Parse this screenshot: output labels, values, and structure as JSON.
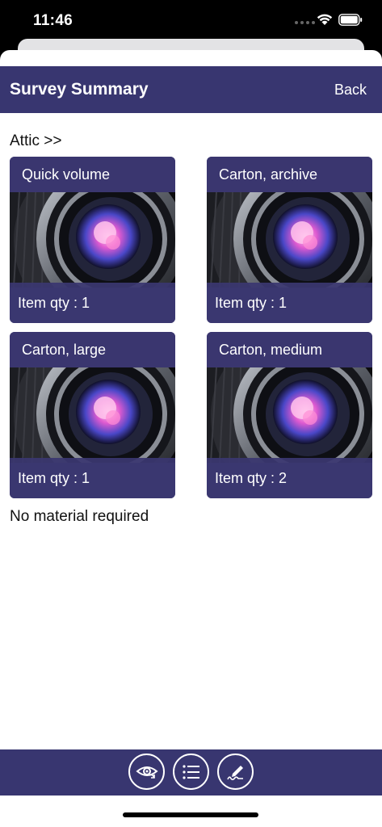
{
  "status": {
    "time": "11:46"
  },
  "nav": {
    "title": "Survey Summary",
    "back_label": "Back"
  },
  "section": {
    "title": "Attic >>"
  },
  "cards": [
    {
      "title": "Quick volume",
      "qty": "Item qty : 1"
    },
    {
      "title": "Carton, archive",
      "qty": "Item qty : 1"
    },
    {
      "title": "Carton, large",
      "qty": "Item qty : 1"
    },
    {
      "title": "Carton, medium",
      "qty": "Item qty : 2"
    }
  ],
  "footer": {
    "note": "No material required"
  },
  "tabbar": {
    "icons": [
      "eye-icon",
      "list-icon",
      "signature-icon"
    ]
  },
  "colors": {
    "nav_background": "#383670",
    "card_overlay": "#3a3770",
    "text_primary": "#111111"
  }
}
